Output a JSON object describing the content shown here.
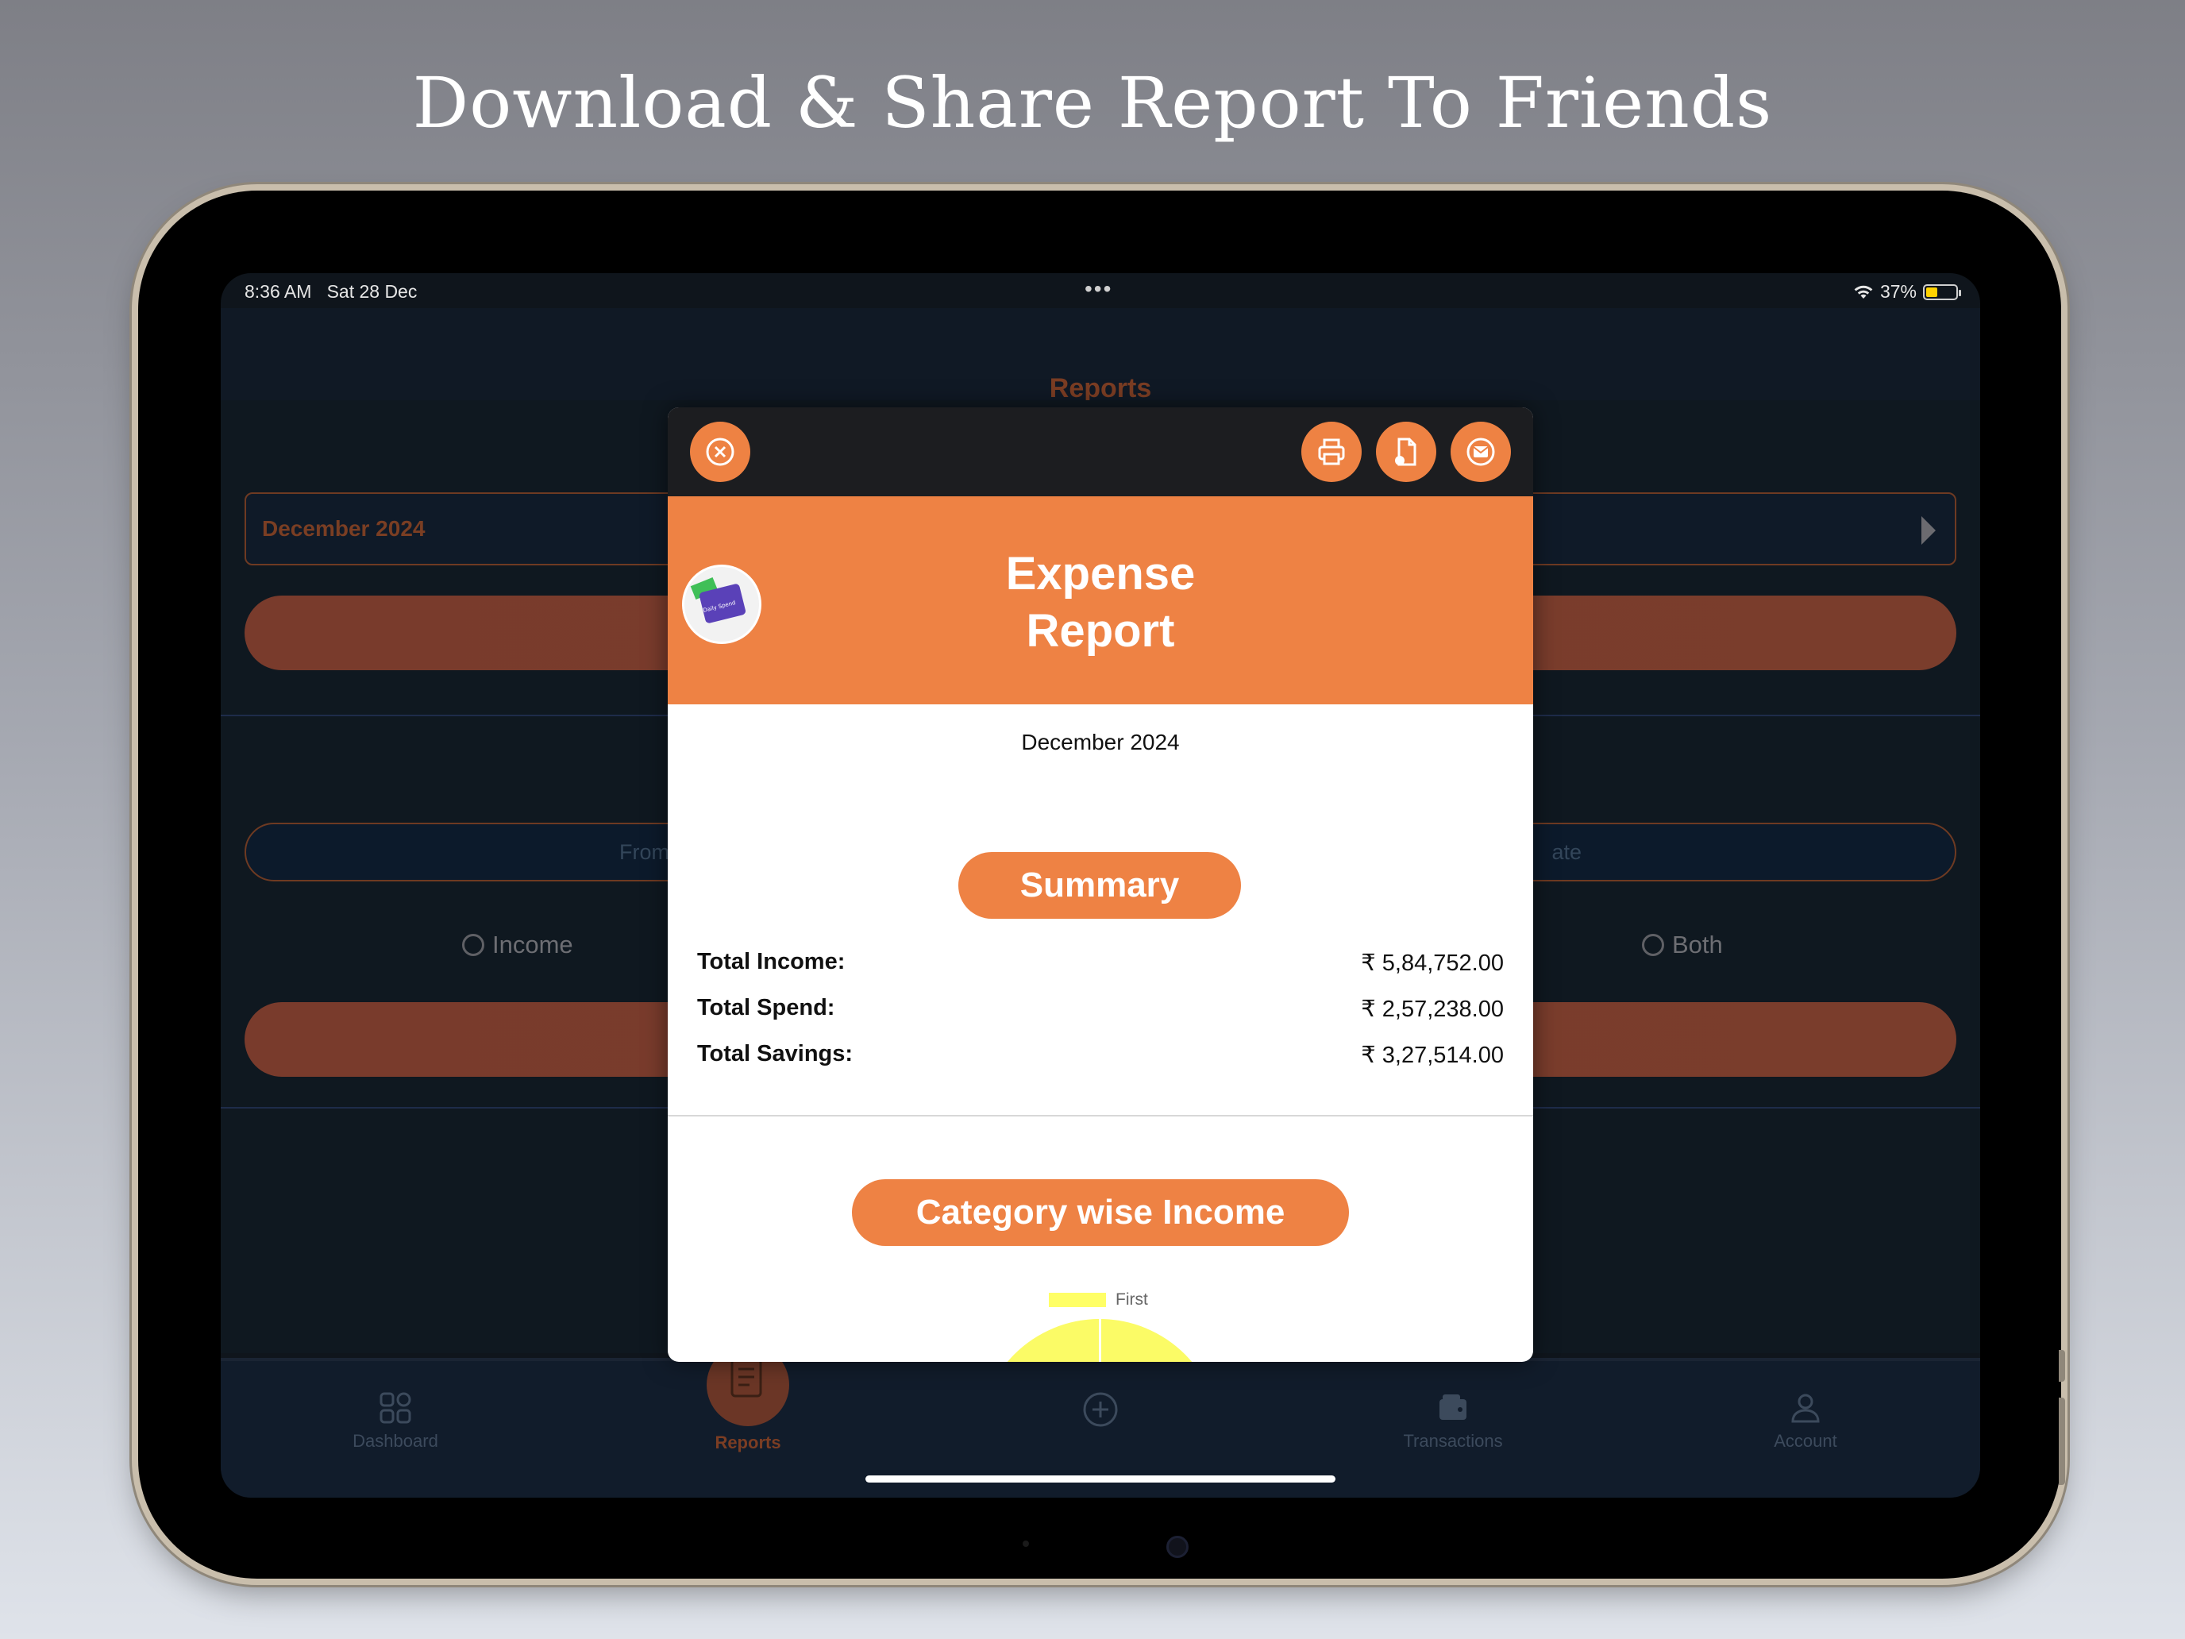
{
  "headline": "Download & Share Report To Friends",
  "status_bar": {
    "time": "8:36 AM",
    "date": "Sat 28 Dec",
    "dots": "•••",
    "battery": "37%"
  },
  "nav": {
    "title": "Reports"
  },
  "background": {
    "month_field": "December 2024",
    "from_placeholder": "From",
    "to_placeholder": "ate",
    "radio_income": "Income",
    "radio_both": "Both"
  },
  "tabs": {
    "dashboard": "Dashboard",
    "reports": "Reports",
    "transactions": "Transactions",
    "account": "Account"
  },
  "report": {
    "title_line1": "Expense",
    "title_line2": "Report",
    "logo_text": "Daily Spend",
    "period": "December 2024",
    "summary_label": "Summary",
    "rows": [
      {
        "label": "Total Income:",
        "value": "₹ 5,84,752.00"
      },
      {
        "label": "Total Spend:",
        "value": "₹ 2,57,238.00"
      },
      {
        "label": "Total Savings:",
        "value": "₹ 3,27,514.00"
      }
    ],
    "category_label": "Category wise Income",
    "legend_first": "First"
  },
  "colors": {
    "accent": "#ee8244",
    "sheet_toolbar": "#1c1d20",
    "legend_first": "#ffff66"
  },
  "icons": {
    "close": "close-circle-icon",
    "print": "printer-icon",
    "pdf": "pdf-document-icon",
    "mail": "mail-icon"
  }
}
